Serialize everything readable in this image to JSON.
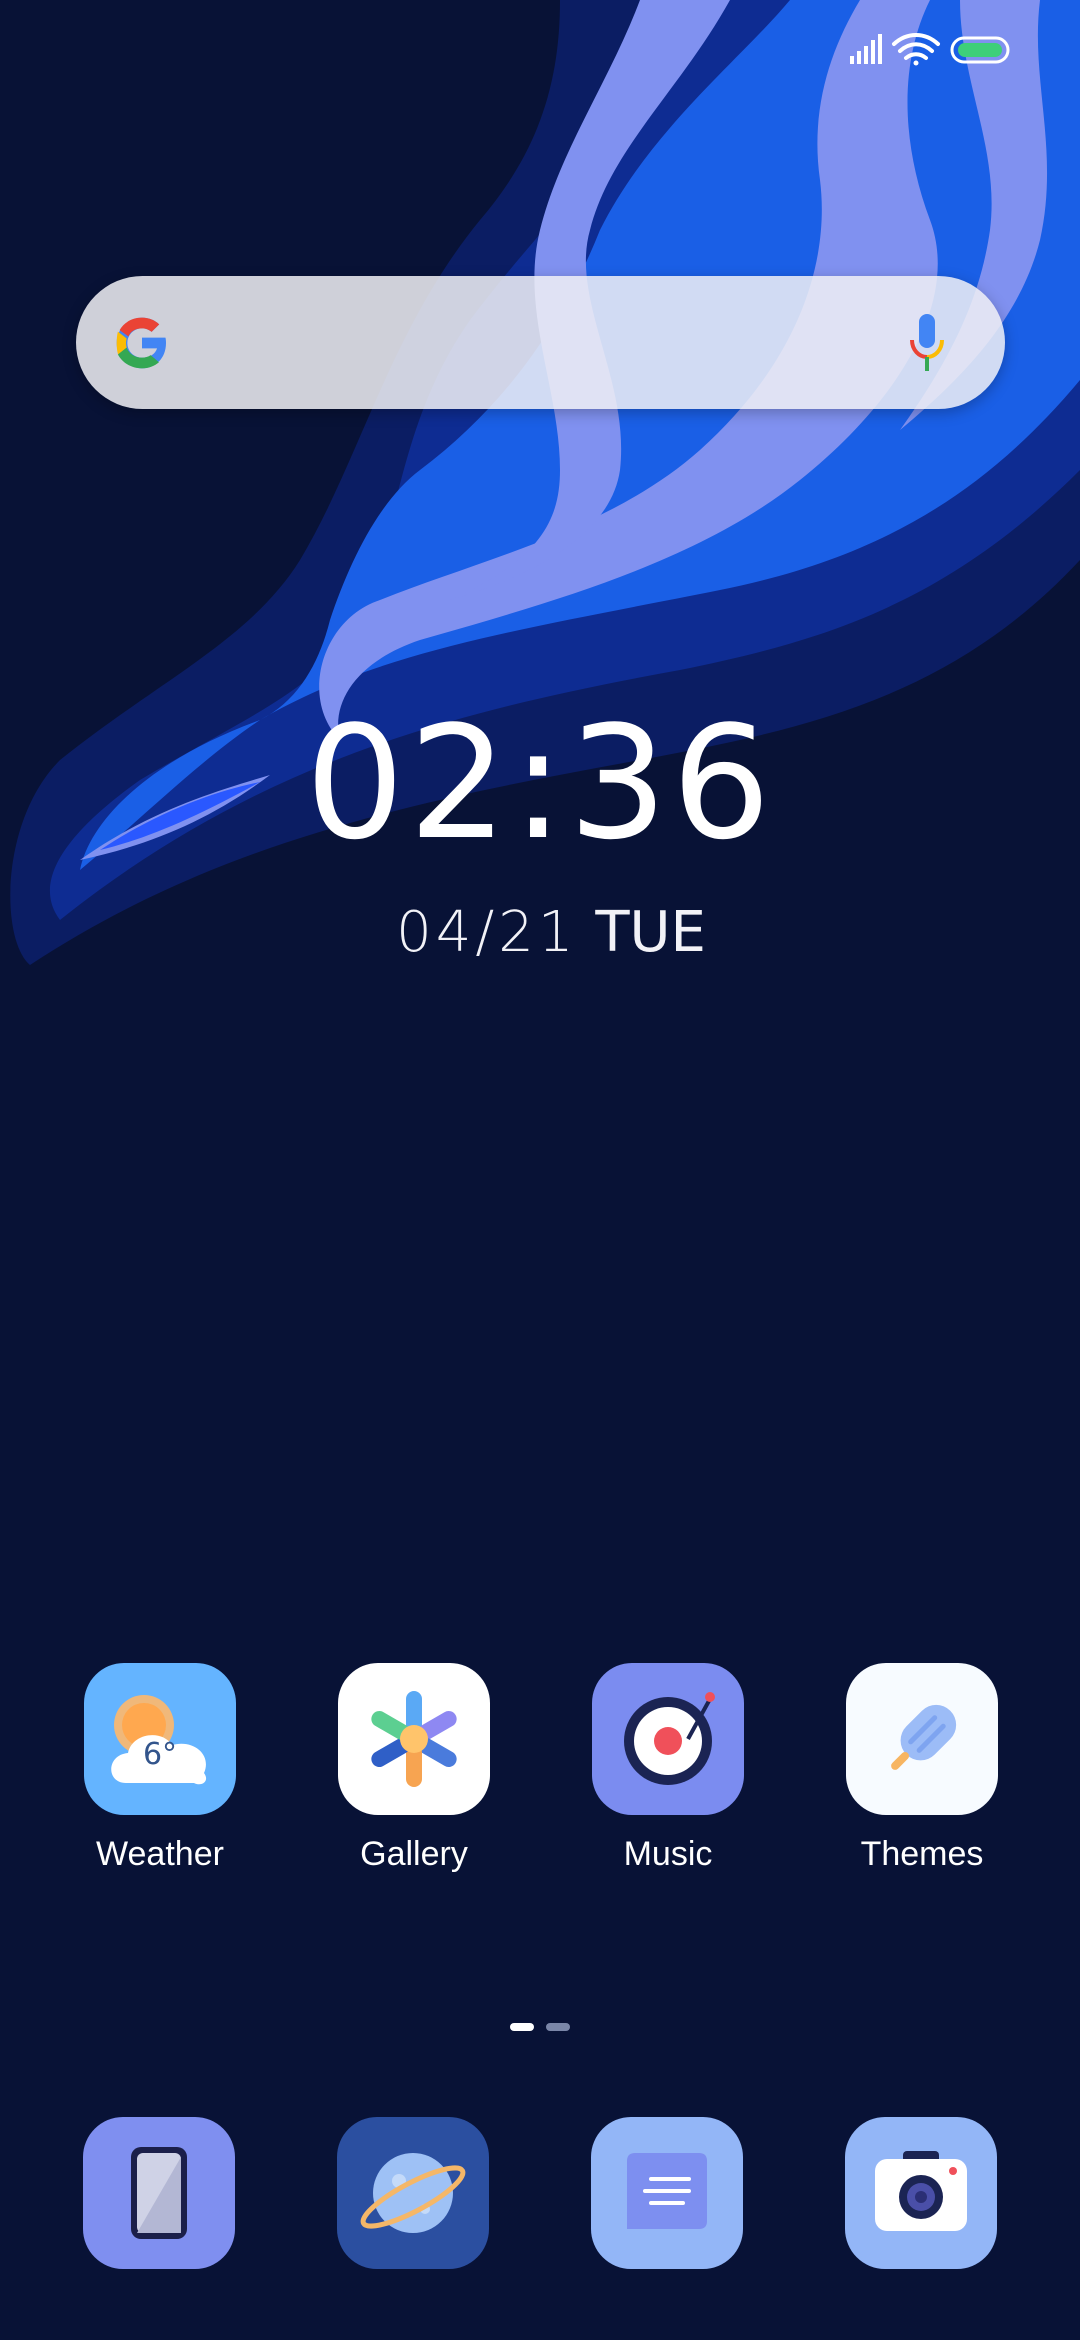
{
  "status_bar": {
    "signal_icon": "cellular-signal-icon",
    "wifi_icon": "wifi-icon",
    "battery_icon": "battery-icon",
    "battery_color": "#3ecf7a"
  },
  "search": {
    "logo_icon": "google-g-icon",
    "mic_icon": "microphone-icon"
  },
  "clock": {
    "time": "02:36",
    "date": "04/21",
    "weekday": "TUE"
  },
  "apps": [
    {
      "label": "Weather",
      "icon": "weather-icon",
      "temp": "6°",
      "bg": "#64b4ff"
    },
    {
      "label": "Gallery",
      "icon": "gallery-icon",
      "bg": "#ffffff"
    },
    {
      "label": "Music",
      "icon": "music-icon",
      "bg": "#7b8cf0"
    },
    {
      "label": "Themes",
      "icon": "themes-icon",
      "bg": "#f7fbff"
    }
  ],
  "page_indicator": {
    "pages": 2,
    "current": 1
  },
  "dock": [
    {
      "icon": "phone-icon",
      "bg": "#7f8ff0"
    },
    {
      "icon": "browser-icon",
      "bg": "#2b4fa0"
    },
    {
      "icon": "messages-icon",
      "bg": "#93b6f7"
    },
    {
      "icon": "camera-icon",
      "bg": "#93b6f7"
    }
  ],
  "colors": {
    "background": "#081236",
    "wave_light": "#8091f0",
    "wave_blue": "#1a5fe6",
    "wave_dark": "#0d2a8c"
  }
}
